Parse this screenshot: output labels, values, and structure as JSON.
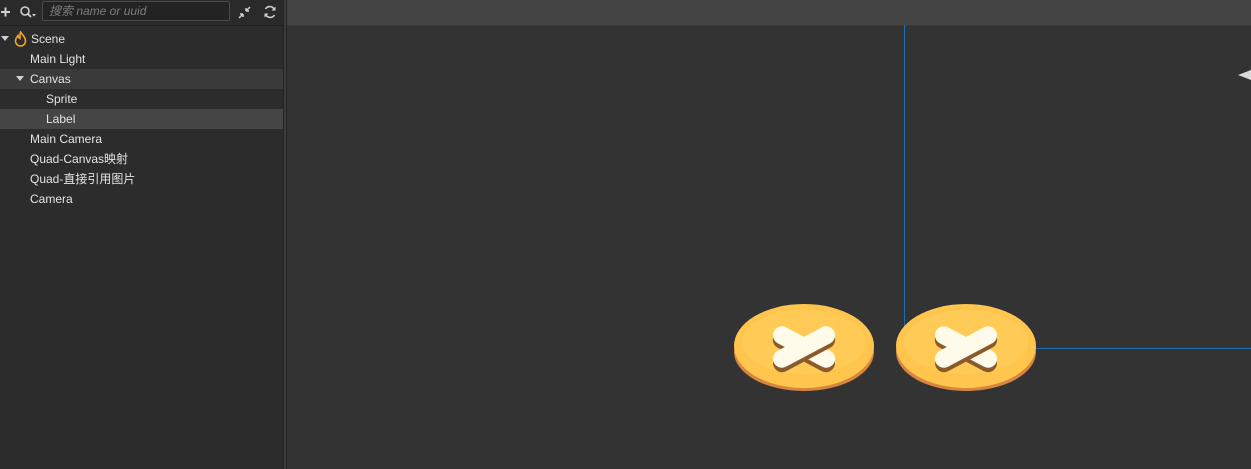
{
  "toolbar": {
    "search_placeholder": "搜索 name or uuid",
    "add_icon": "plus-icon",
    "search_menu_icon": "search-icon",
    "collapse_icon": "collapse-icon",
    "refresh_icon": "refresh-icon"
  },
  "hierarchy": {
    "items": [
      {
        "label": "Scene",
        "depth": 0,
        "expandable": true,
        "icon": "scene-fire-icon"
      },
      {
        "label": "Main Light",
        "depth": 1,
        "expandable": false
      },
      {
        "label": "Canvas",
        "depth": 1,
        "expandable": true,
        "state": "hover"
      },
      {
        "label": "Sprite",
        "depth": 2,
        "expandable": false
      },
      {
        "label": "Label",
        "depth": 2,
        "expandable": false,
        "state": "selected"
      },
      {
        "label": "Main Camera",
        "depth": 1,
        "expandable": false
      },
      {
        "label": "Quad-Canvas映射",
        "depth": 1,
        "expandable": false
      },
      {
        "label": "Quad-直接引用图片",
        "depth": 1,
        "expandable": false
      },
      {
        "label": "Camera",
        "depth": 1,
        "expandable": false
      }
    ]
  },
  "scene_view": {
    "canvas_outline_color": "#1d6fb3",
    "buttons": [
      {
        "name": "close-button-sprite",
        "icon": "close-icon",
        "color": "#ffc54d"
      },
      {
        "name": "close-button-label",
        "icon": "close-icon",
        "color": "#ffc54d"
      }
    ],
    "gizmo_icon": "camera-gizmo-icon"
  }
}
